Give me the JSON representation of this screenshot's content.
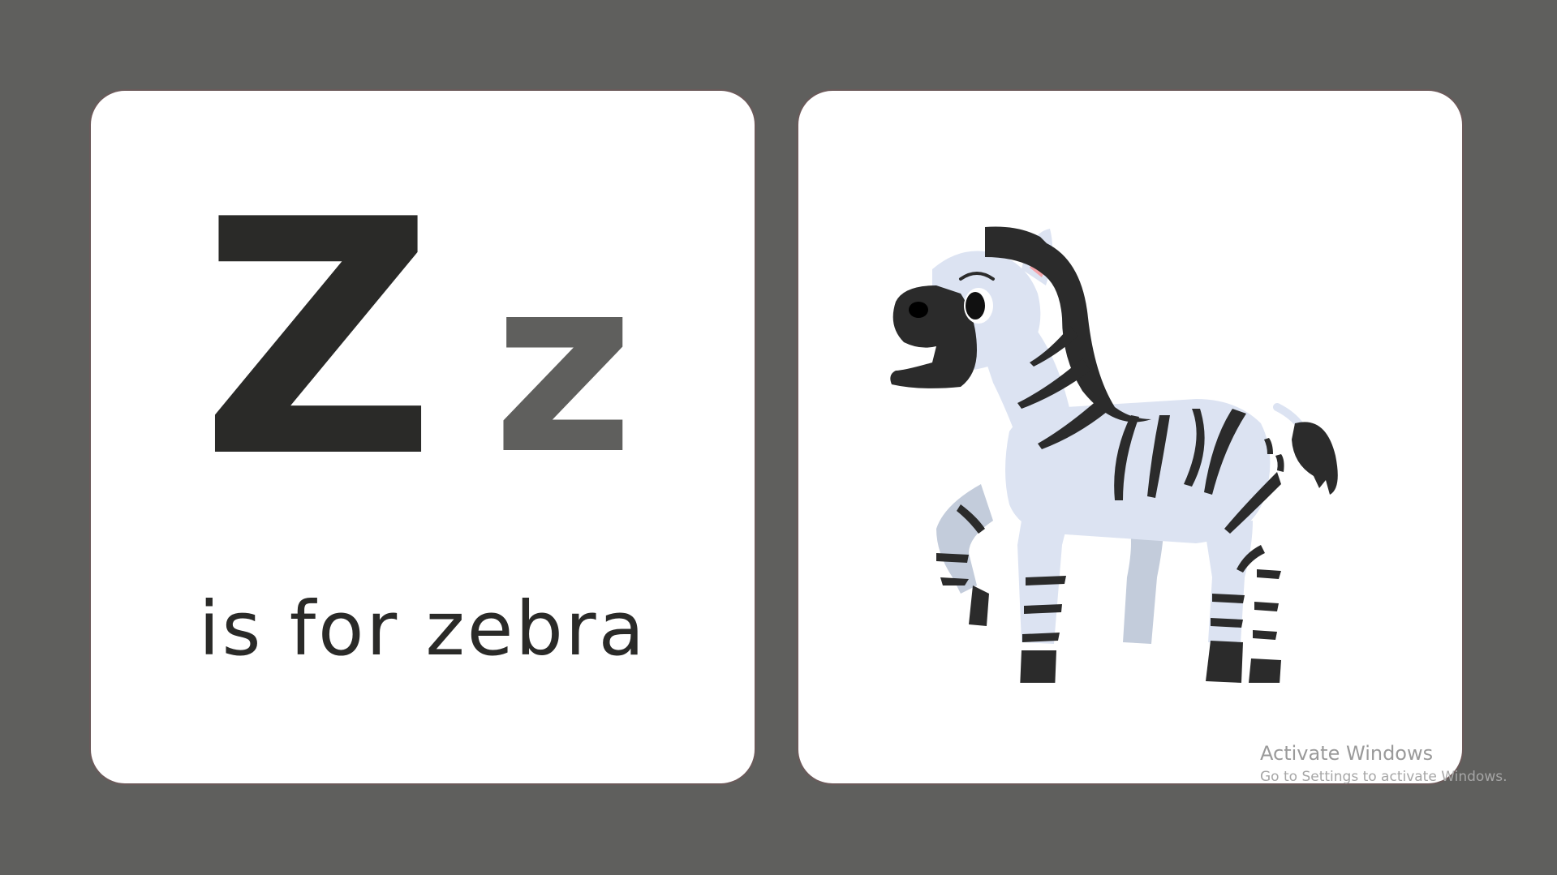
{
  "flashcard": {
    "letter_upper": "Z",
    "letter_lower": "z",
    "caption": "is for zebra",
    "image_subject": "zebra"
  },
  "watermark": {
    "title": "Activate Windows",
    "subtitle": "Go to Settings to activate Windows."
  },
  "colors": {
    "background": "#5f5f5d",
    "card": "#ffffff",
    "card_border": "#6b5a5a",
    "letter_upper": "#2a2a28",
    "letter_lower": "#5f5f5d",
    "zebra_body": "#dce3f2",
    "zebra_shadow": "#c3ccdb",
    "zebra_stripes": "#2b2b2b",
    "zebra_ear_inner": "#f4a3a9"
  }
}
